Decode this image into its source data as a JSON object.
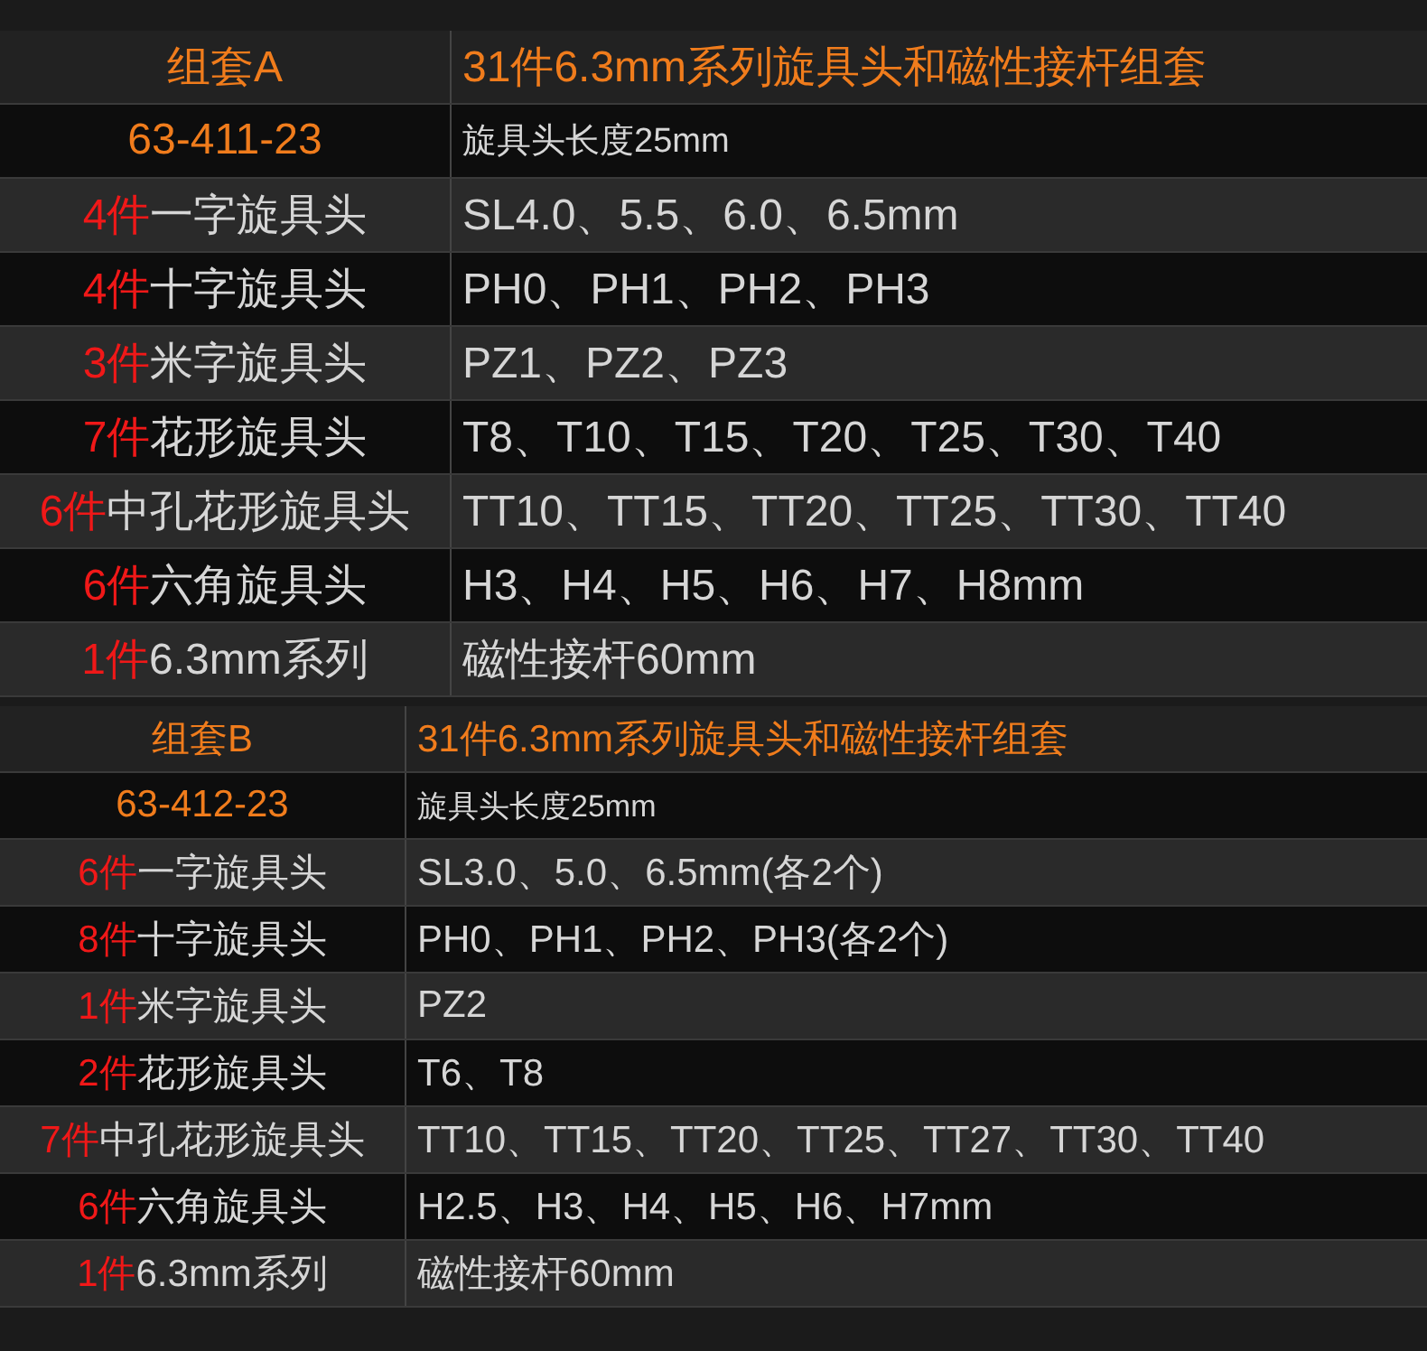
{
  "sets": [
    {
      "title": "组套A",
      "subtitle": "31件6.3mm系列旋具头和磁性接杆组套",
      "code": "63-411-23",
      "spec": "旋具头长度25mm",
      "items": [
        {
          "count": "4件",
          "name": "一字旋具头",
          "value": "SL4.0、5.5、6.0、6.5mm"
        },
        {
          "count": "4件",
          "name": "十字旋具头",
          "value": "PH0、PH1、PH2、PH3"
        },
        {
          "count": "3件",
          "name": "米字旋具头",
          "value": "PZ1、PZ2、PZ3"
        },
        {
          "count": "7件",
          "name": "花形旋具头",
          "value": "T8、T10、T15、T20、T25、T30、T40"
        },
        {
          "count": "6件",
          "name": "中孔花形旋具头",
          "value": "TT10、TT15、TT20、TT25、TT30、TT40"
        },
        {
          "count": "6件",
          "name": "六角旋具头",
          "value": "H3、H4、H5、H6、H7、H8mm"
        },
        {
          "count": "1件",
          "name": "6.3mm系列",
          "value": "磁性接杆60mm"
        }
      ]
    },
    {
      "title": "组套B",
      "subtitle": "31件6.3mm系列旋具头和磁性接杆组套",
      "code": "63-412-23",
      "spec": "旋具头长度25mm",
      "items": [
        {
          "count": "6件",
          "name": "一字旋具头",
          "value": "SL3.0、5.0、6.5mm(各2个)"
        },
        {
          "count": "8件",
          "name": "十字旋具头",
          "value": "PH0、PH1、PH2、PH3(各2个)"
        },
        {
          "count": "1件",
          "name": "米字旋具头",
          "value": "PZ2"
        },
        {
          "count": "2件",
          "name": "花形旋具头",
          "value": "T6、T8"
        },
        {
          "count": "7件",
          "name": "中孔花形旋具头",
          "value": "TT10、TT15、TT20、TT25、TT27、TT30、TT40"
        },
        {
          "count": "6件",
          "name": "六角旋具头",
          "value": "H2.5、H3、H4、H5、H6、H7mm"
        },
        {
          "count": "1件",
          "name": "6.3mm系列",
          "value": "磁性接杆60mm"
        }
      ]
    }
  ]
}
